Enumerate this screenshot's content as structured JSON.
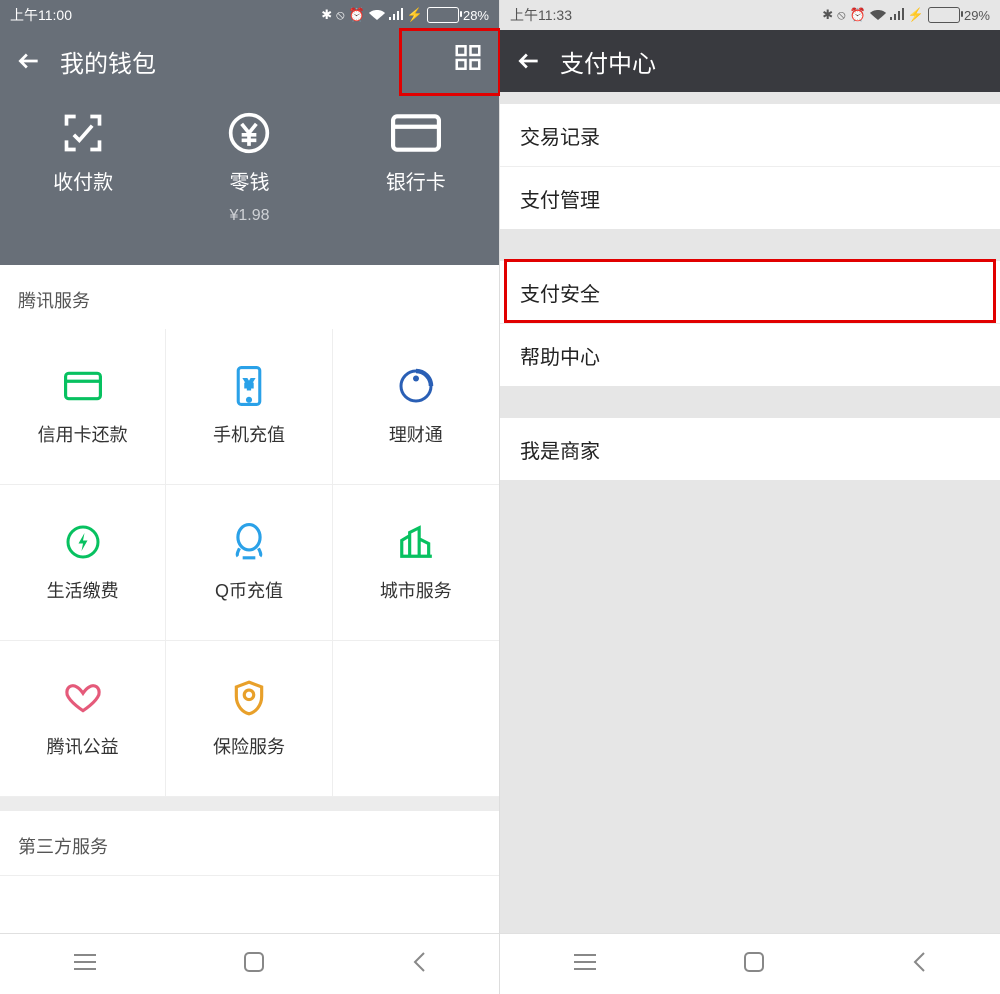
{
  "left": {
    "status": {
      "time": "上午11:00",
      "battery_pct": "28%"
    },
    "title": "我的钱包",
    "tiles": [
      {
        "label": "收付款"
      },
      {
        "label": "零钱",
        "sublabel": "¥1.98"
      },
      {
        "label": "银行卡"
      }
    ],
    "section1": "腾讯服务",
    "services": [
      "信用卡还款",
      "手机充值",
      "理财通",
      "生活缴费",
      "Q币充值",
      "城市服务",
      "腾讯公益",
      "保险服务"
    ],
    "section2": "第三方服务"
  },
  "right": {
    "status": {
      "time": "上午11:33",
      "battery_pct": "29%"
    },
    "title": "支付中心",
    "group1": [
      "交易记录",
      "支付管理"
    ],
    "group2": [
      "支付安全",
      "帮助中心"
    ],
    "group3": [
      "我是商家"
    ]
  }
}
